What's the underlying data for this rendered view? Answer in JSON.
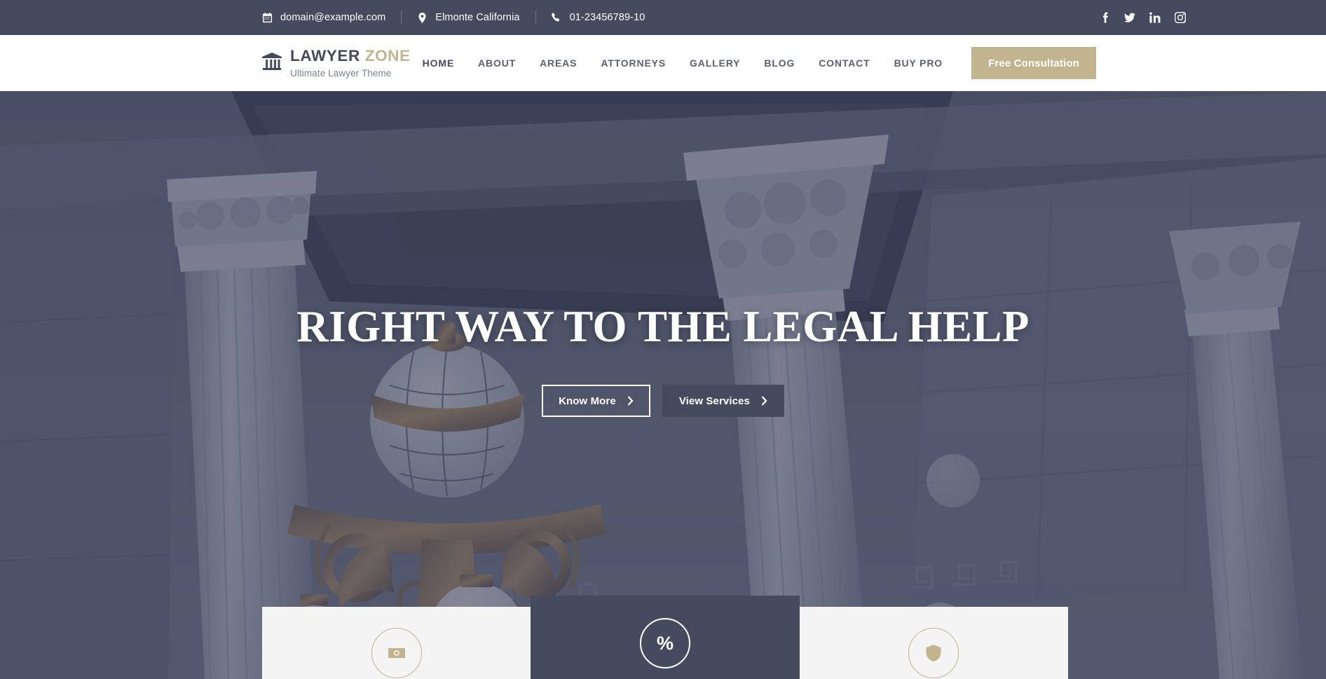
{
  "topbar": {
    "email": "domain@example.com",
    "location": "Elmonte California",
    "phone": "01-23456789-10",
    "socials": [
      {
        "name": "facebook",
        "label": "Facebook"
      },
      {
        "name": "twitter",
        "label": "Twitter"
      },
      {
        "name": "linkedin",
        "label": "LinkedIn"
      },
      {
        "name": "instagram",
        "label": "Instagram"
      }
    ]
  },
  "brand": {
    "word1": "LAWYER",
    "word2": "ZONE",
    "tagline": "Ultimate Lawyer Theme",
    "icon": "bank-icon"
  },
  "nav": {
    "items": [
      {
        "label": "HOME",
        "active": true
      },
      {
        "label": "ABOUT",
        "active": false
      },
      {
        "label": "AREAS",
        "active": false
      },
      {
        "label": "ATTORNEYS",
        "active": false
      },
      {
        "label": "GALLERY",
        "active": false
      },
      {
        "label": "BLOG",
        "active": false
      },
      {
        "label": "CONTACT",
        "active": false
      },
      {
        "label": "BUY PRO",
        "active": false
      }
    ],
    "cta_label": "Free Consultation"
  },
  "hero": {
    "title": "RIGHT WAY TO THE LEGAL HELP",
    "primary_button": "Know More",
    "secondary_button": "View Services"
  },
  "cards": [
    {
      "icon": "money-bill-icon",
      "style": "light"
    },
    {
      "icon": "percent-icon",
      "style": "dark",
      "glyph": "%"
    },
    {
      "icon": "shield-icon",
      "style": "light"
    }
  ],
  "colors": {
    "navy": "#454A5F",
    "tan": "#C2B48E",
    "light_card": "#F4F4F4",
    "nav_text": "#5a5f73"
  }
}
